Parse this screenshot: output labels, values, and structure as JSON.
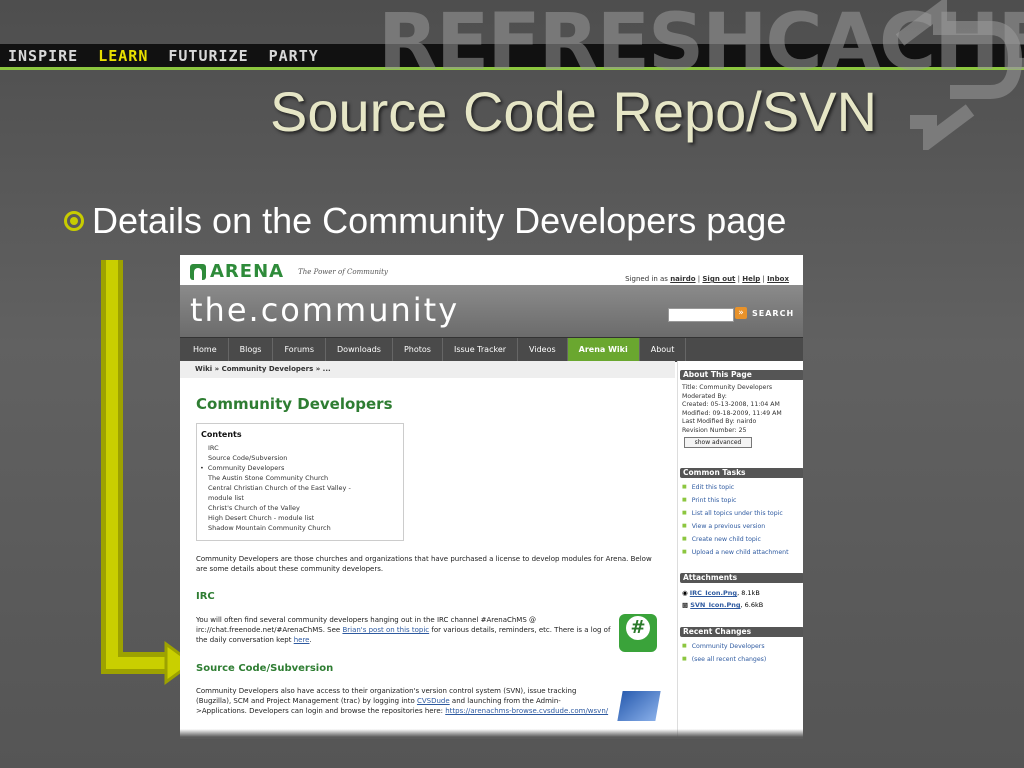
{
  "slide": {
    "nav": [
      "INSPIRE",
      "LEARN",
      "FUTURIZE",
      "PARTY"
    ],
    "nav_active": "LEARN",
    "logo": "REFRESHCACHE",
    "title": "Source Code Repo/SVN",
    "bullet": "Details on the Community Developers page",
    "colors": {
      "accent": "#c7cc00",
      "nav_line": "#8cc63f",
      "title": "#e6e6c6"
    }
  },
  "screenshot": {
    "brand": "ARENA",
    "tagline": "The Power of Community",
    "signed_in_prefix": "Signed in as",
    "user": "nairdo",
    "sign_out": "Sign out",
    "help": "Help",
    "inbox": "Inbox",
    "site_name": "the.community",
    "search_label": "SEARCH",
    "menu": [
      "Home",
      "Blogs",
      "Forums",
      "Downloads",
      "Photos",
      "Issue Tracker",
      "Videos",
      "Arena Wiki",
      "About"
    ],
    "menu_active": "Arena Wiki",
    "breadcrumb": "Wiki » Community Developers » ...",
    "page_title": "Community Developers",
    "contents_title": "Contents",
    "contents": [
      "IRC",
      "Source Code/Subversion",
      "Community Developers",
      "The Austin Stone Community Church",
      "Central Christian Church of the East Valley -",
      "module list",
      "Christ's Church of the Valley",
      "High Desert Church - module list",
      "Shadow Mountain Community Church"
    ],
    "intro": "Community Developers are those churches and organizations that have purchased a license to develop modules for Arena. Below are some details about these community developers.",
    "irc_heading": "IRC",
    "irc_text_1": "You will often find several community developers hanging out in the IRC channel #ArenaChMS @ irc://chat.freenode.net/#ArenaChMS. See",
    "irc_link": "Brian's post on this topic",
    "irc_text_2": "for various details, reminders, etc. There is a log of the daily conversation kept",
    "irc_here": "here",
    "svn_heading": "Source Code/Subversion",
    "svn_text_1": "Community Developers also have access to their organization's version control system (SVN), issue tracking (Bugzilla), SCM and Project Management (trac) by logging into",
    "svn_link": "CVSDude",
    "svn_text_2": "and launching from the Admin->Applications. Developers can login and browse the repositories here:",
    "svn_url": "https://arenachms-browse.cvsdude.com/wsvn/",
    "sidebar": {
      "about_title": "About This Page",
      "about_lines": [
        "Title: Community Developers",
        "Moderated By:",
        "Created: 05-13-2008, 11:04 AM",
        "Modified: 09-18-2009, 11:49 AM",
        "Last Modified By: nairdo",
        "Revision Number: 25"
      ],
      "show_advanced": "show advanced",
      "tasks_title": "Common Tasks",
      "tasks": [
        "Edit this topic",
        "Print this topic",
        "List all topics under this topic",
        "View a previous version",
        "Create new child topic",
        "Upload a new child attachment"
      ],
      "attachments_title": "Attachments",
      "attachments": [
        {
          "name": "IRC_Icon.Png",
          "size": "8.1kB"
        },
        {
          "name": "SVN_Icon.Png",
          "size": "6.6kB"
        }
      ],
      "recent_title": "Recent Changes",
      "recent": [
        "Community Developers",
        "(see all recent changes)"
      ]
    }
  }
}
